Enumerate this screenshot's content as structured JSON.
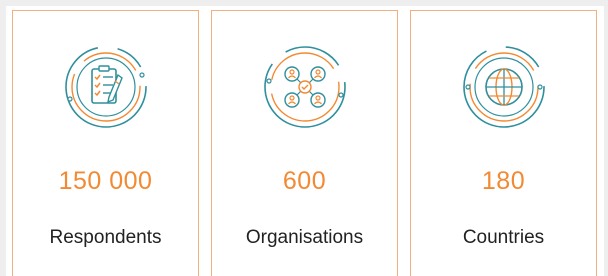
{
  "colors": {
    "accent": "#f28a33",
    "icon_teal": "#2f8f9d",
    "card_border": "#f3b07e",
    "text": "#222222"
  },
  "stats": [
    {
      "icon": "survey-checklist-icon",
      "value": "150 000",
      "label": "Respondents"
    },
    {
      "icon": "organisations-network-icon",
      "value": "600",
      "label": "Organisations"
    },
    {
      "icon": "globe-icon",
      "value": "180",
      "label": "Countries"
    }
  ]
}
